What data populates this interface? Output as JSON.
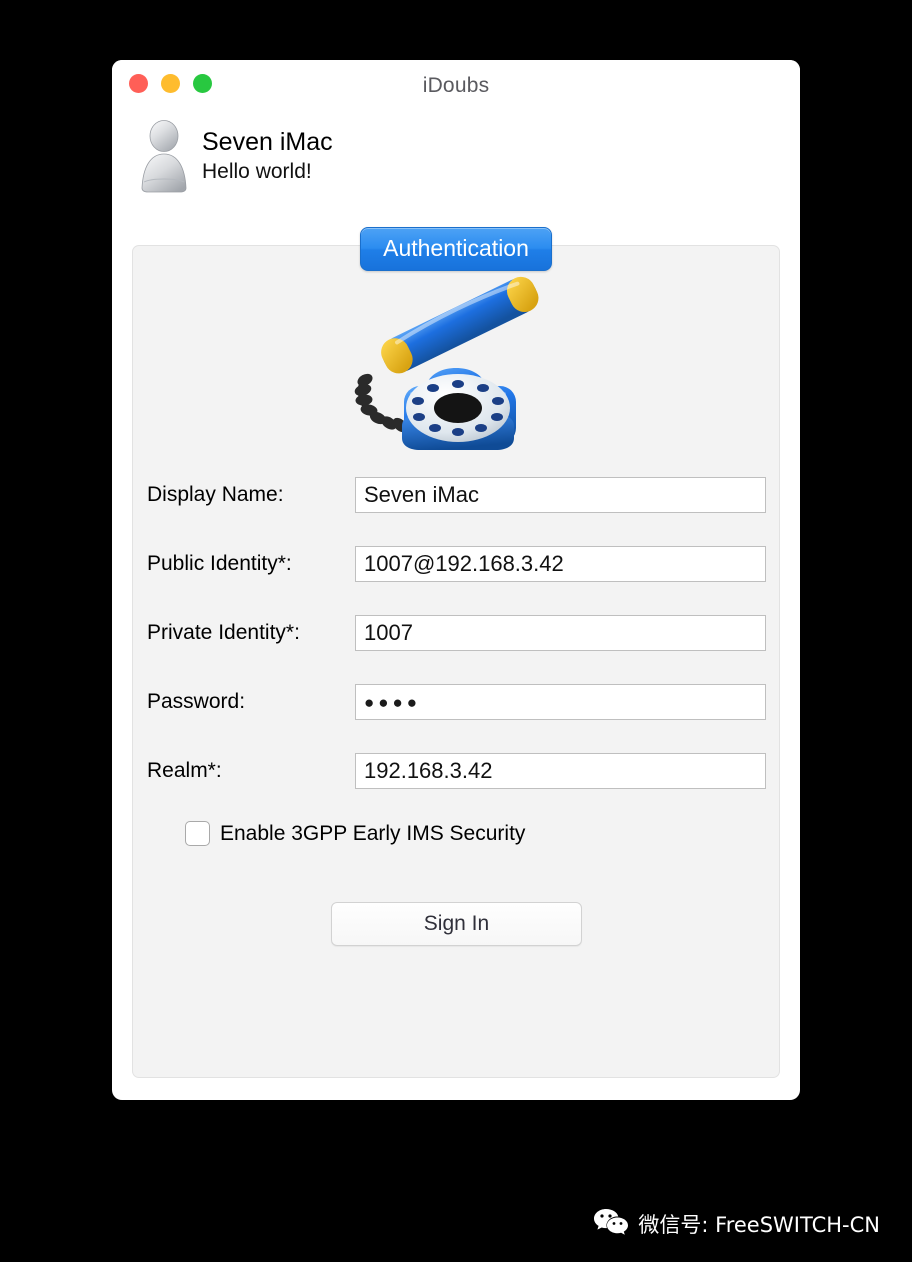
{
  "window": {
    "title": "iDoubs",
    "traffic_lights": [
      {
        "name": "close",
        "color": "#ff5f57"
      },
      {
        "name": "minimize",
        "color": "#febc2e"
      },
      {
        "name": "zoom",
        "color": "#28c840"
      }
    ]
  },
  "account": {
    "avatar_icon": "person-avatar-icon",
    "name": "Seven iMac",
    "status": "Hello world!"
  },
  "tabs": [
    {
      "label": "Authentication",
      "selected": true,
      "color": "#2b8cf0"
    }
  ],
  "panel": {
    "hero_icon": "rotary-telephone-icon",
    "fields": [
      {
        "label": "Display Name:",
        "value": "Seven iMac",
        "type": "text"
      },
      {
        "label": "Public Identity*:",
        "value": "1007@192.168.3.42",
        "type": "text"
      },
      {
        "label": "Private Identity*:",
        "value": "1007",
        "type": "text"
      },
      {
        "label": "Password:",
        "value": "●●●●",
        "type": "password"
      },
      {
        "label": "Realm*:",
        "value": "192.168.3.42",
        "type": "text"
      }
    ],
    "checkbox": {
      "label": "Enable 3GPP Early IMS Security",
      "checked": false
    },
    "submit_label": "Sign In"
  },
  "watermark": {
    "icon": "wechat-icon",
    "text": "微信号: FreeSWITCH-CN"
  }
}
